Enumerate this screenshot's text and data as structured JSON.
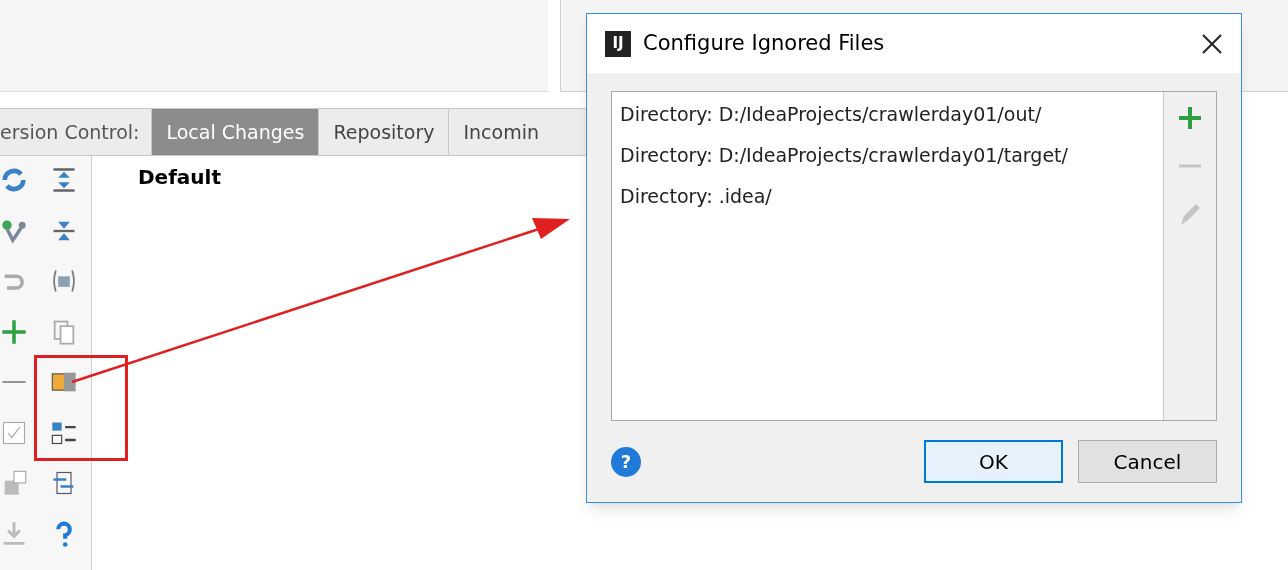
{
  "tool_window": {
    "label": "ersion Control:",
    "tabs": [
      {
        "label": "Local Changes",
        "selected": true
      },
      {
        "label": "Repository",
        "selected": false
      },
      {
        "label": "Incomin",
        "selected": false
      }
    ],
    "changelist": "Default"
  },
  "dialog": {
    "logo": "IJ",
    "title": "Configure Ignored Files",
    "entries": [
      "Directory: D:/IdeaProjects/crawlerday01/out/",
      "Directory: D:/IdeaProjects/crawlerday01/target/",
      "Directory: .idea/"
    ],
    "help": "?",
    "buttons": [
      {
        "label": "OK",
        "default": true
      },
      {
        "label": "Cancel",
        "default": false
      }
    ]
  }
}
